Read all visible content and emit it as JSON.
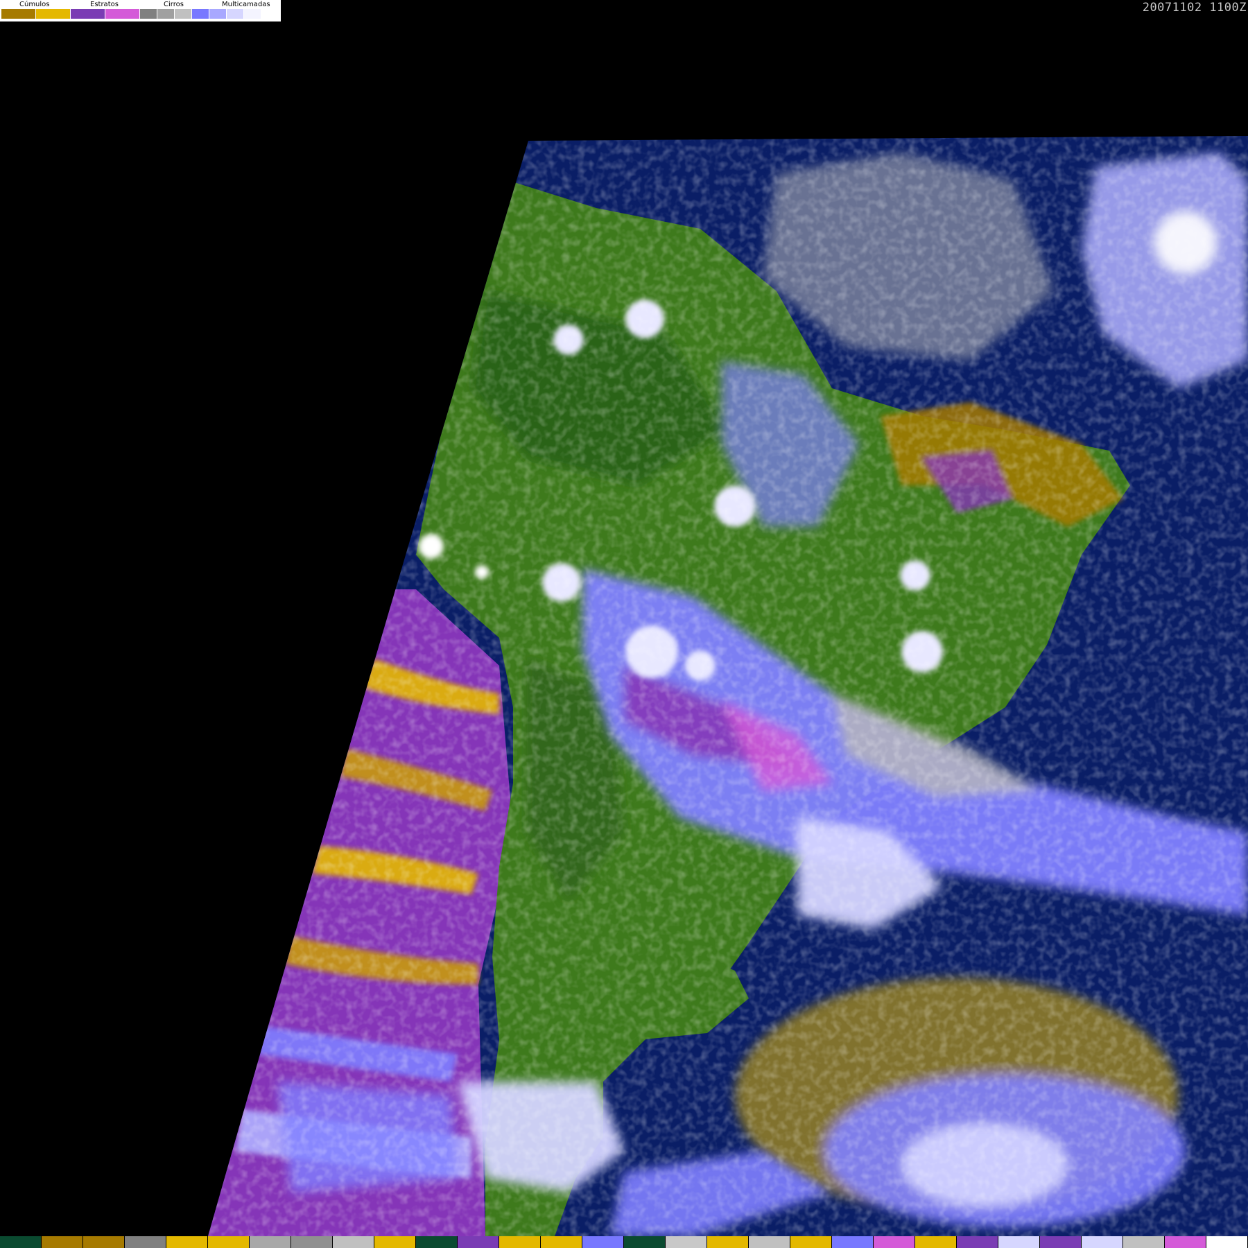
{
  "timestamp": "20071102 1100Z",
  "legend": {
    "groups": [
      {
        "label": "Cúmulos",
        "colors": [
          "#a67a00",
          "#e4b800"
        ]
      },
      {
        "label": "Estratos",
        "colors": [
          "#7a3cb4",
          "#d45ad8"
        ]
      },
      {
        "label": "Cirros",
        "colors": [
          "#808080",
          "#a0a0a0",
          "#c0c0c0"
        ]
      },
      {
        "label": "Multicamadas",
        "colors": [
          "#7878ff",
          "#a8a8ff",
          "#d6d6ff",
          "#f4f4ff"
        ]
      }
    ]
  },
  "colors": {
    "background": "#000000",
    "ocean": "#0a1e66",
    "land": "#3e7a1c",
    "land_dark": "#245a14",
    "stratus": "#8535b8",
    "cumulus_dark": "#a67a00",
    "cumulus_light": "#e4b800",
    "cirrus": "#b8b8b8",
    "multilayer": "#7f7fff",
    "multilayer_light": "#d4d4ff"
  },
  "bottom_strip": [
    "#0a4a30",
    "#a67a00",
    "#a67a00",
    "#808080",
    "#e4b800",
    "#e4b800",
    "#a8a8a8",
    "#909090",
    "#c0c0c0",
    "#e4b800",
    "#0a4a30",
    "#7a3cb4",
    "#e4b800",
    "#e4b800",
    "#7878ff",
    "#0a4a30",
    "#c8c8c8",
    "#e4b800",
    "#c0c0c0",
    "#e4b800",
    "#7878ff",
    "#d45ad8",
    "#e4b800",
    "#7a3cb4",
    "#d6d6ff",
    "#7a3cb4",
    "#d6d6ff",
    "#c0c0c0",
    "#d45ad8",
    "#ffffff"
  ]
}
